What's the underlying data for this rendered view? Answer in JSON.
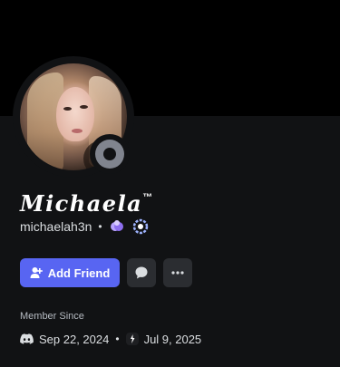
{
  "profile": {
    "display_name": "Michaela",
    "display_name_mark": "™",
    "username": "michaelah3n",
    "separator": "•"
  },
  "actions": {
    "add_friend_label": "Add Friend",
    "message_icon": "chat-bubble-icon",
    "more_icon": "ellipsis-icon"
  },
  "member_since": {
    "label": "Member Since",
    "discord_date": "Sep 22, 2024",
    "separator": "•",
    "server_date": "Jul 9, 2025"
  },
  "colors": {
    "accent": "#5865f2",
    "background": "#111214",
    "banner": "#000000",
    "status_offline": "#80848e"
  },
  "badges": [
    "nitro-boost-gem-icon",
    "hypesquad-ring-icon"
  ]
}
